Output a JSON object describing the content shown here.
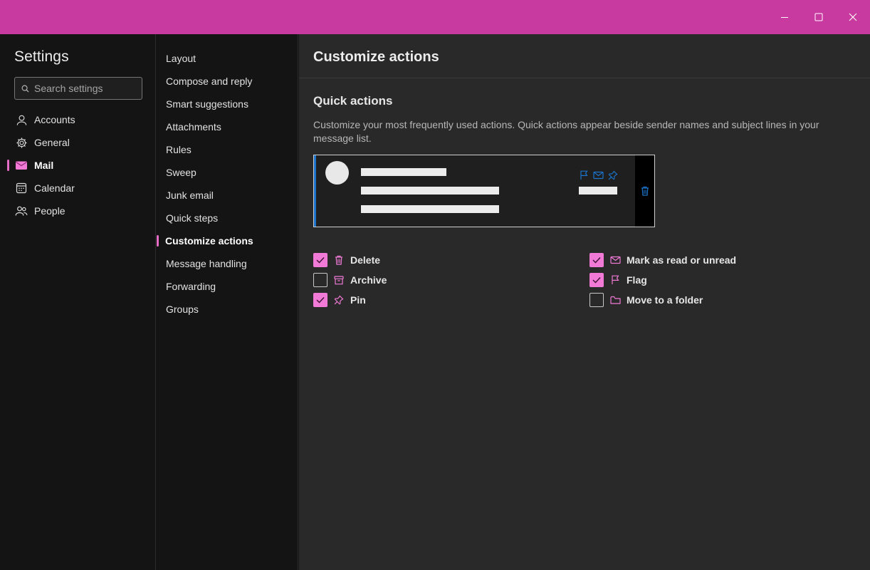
{
  "colors": {
    "titlebar": "#c93aa0",
    "accent": "#e46cc4",
    "checkbox_on": "#f07ad6",
    "preview_icons": "#1a73c9"
  },
  "window_controls": {
    "minimize": "minimize-icon",
    "maximize": "maximize-icon",
    "close": "close-icon"
  },
  "sidebar": {
    "title": "Settings",
    "search_placeholder": "Search settings",
    "items": [
      {
        "label": "Accounts",
        "icon": "person-icon",
        "active": false
      },
      {
        "label": "General",
        "icon": "gear-icon",
        "active": false
      },
      {
        "label": "Mail",
        "icon": "mail-icon",
        "active": true
      },
      {
        "label": "Calendar",
        "icon": "calendar-icon",
        "active": false
      },
      {
        "label": "People",
        "icon": "people-icon",
        "active": false
      }
    ]
  },
  "subnav": {
    "items": [
      {
        "label": "Layout",
        "active": false
      },
      {
        "label": "Compose and reply",
        "active": false
      },
      {
        "label": "Smart suggestions",
        "active": false
      },
      {
        "label": "Attachments",
        "active": false
      },
      {
        "label": "Rules",
        "active": false
      },
      {
        "label": "Sweep",
        "active": false
      },
      {
        "label": "Junk email",
        "active": false
      },
      {
        "label": "Quick steps",
        "active": false
      },
      {
        "label": "Customize actions",
        "active": true
      },
      {
        "label": "Message handling",
        "active": false
      },
      {
        "label": "Forwarding",
        "active": false
      },
      {
        "label": "Groups",
        "active": false
      }
    ]
  },
  "main": {
    "title": "Customize actions",
    "section_title": "Quick actions",
    "description": "Customize your most frequently used actions. Quick actions appear beside sender names and subject lines in your message list.",
    "preview": {
      "icons": [
        "flag-icon",
        "mail-icon",
        "pin-icon"
      ],
      "hover_icon": "trash-icon"
    },
    "actions": [
      {
        "label": "Delete",
        "icon": "trash-icon",
        "checked": true
      },
      {
        "label": "Archive",
        "icon": "archive-icon",
        "checked": false
      },
      {
        "label": "Pin",
        "icon": "pin-icon",
        "checked": true
      },
      {
        "label": "Mark as read or unread",
        "icon": "mail-icon",
        "checked": true
      },
      {
        "label": "Flag",
        "icon": "flag-icon",
        "checked": true
      },
      {
        "label": "Move to a folder",
        "icon": "folder-icon",
        "checked": false
      }
    ]
  }
}
